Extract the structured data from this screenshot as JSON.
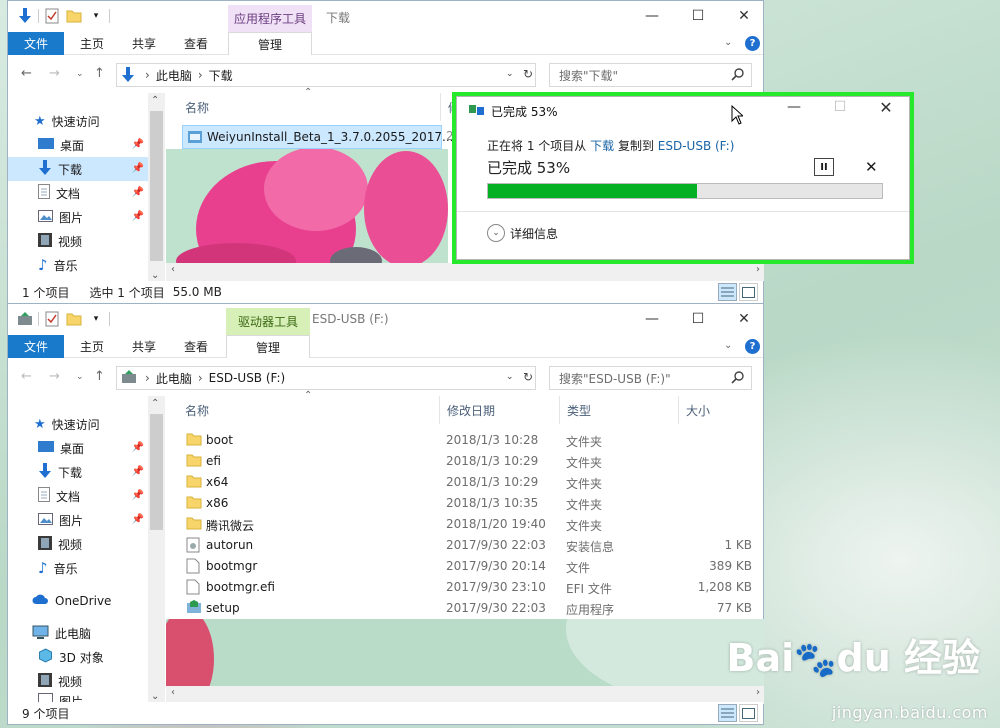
{
  "window1": {
    "context_tab": "应用程序工具",
    "title": "下载",
    "ribbon_tabs": [
      "文件",
      "主页",
      "共享",
      "查看",
      "管理"
    ],
    "address": {
      "root": "此电脑",
      "sep": "›",
      "folder": "下载"
    },
    "search_placeholder": "搜索\"下载\"",
    "nav": [
      {
        "label": "快速访问"
      },
      {
        "label": "桌面"
      },
      {
        "label": "下载"
      },
      {
        "label": "文档"
      },
      {
        "label": "图片"
      },
      {
        "label": "视频"
      },
      {
        "label": "音乐"
      }
    ],
    "col_name": "名称",
    "col_date_partial": "修",
    "file": {
      "name": "WeiyunInstall_Beta_1_3.7.0.2055_2017...",
      "date_partial": "2("
    },
    "status": {
      "items": "1 个项目",
      "selected": "选中 1 个项目",
      "size": "55.0 MB"
    }
  },
  "window2": {
    "context_tab": "驱动器工具",
    "title": "ESD-USB (F:)",
    "ribbon_tabs": [
      "文件",
      "主页",
      "共享",
      "查看",
      "管理"
    ],
    "address": {
      "root": "此电脑",
      "sep": "›",
      "folder": "ESD-USB (F:)"
    },
    "search_placeholder": "搜索\"ESD-USB (F:)\"",
    "nav": [
      {
        "label": "快速访问"
      },
      {
        "label": "桌面"
      },
      {
        "label": "下载"
      },
      {
        "label": "文档"
      },
      {
        "label": "图片"
      },
      {
        "label": "视频"
      },
      {
        "label": "音乐"
      },
      {
        "label": "OneDrive"
      },
      {
        "label": "此电脑"
      },
      {
        "label": "3D 对象"
      },
      {
        "label": "视频"
      },
      {
        "label": "图片"
      }
    ],
    "columns": {
      "name": "名称",
      "date": "修改日期",
      "type": "类型",
      "size": "大小"
    },
    "files": [
      {
        "name": "boot",
        "date": "2018/1/3 10:28",
        "type": "文件夹",
        "size": "",
        "icon": "folder-icon"
      },
      {
        "name": "efi",
        "date": "2018/1/3 10:29",
        "type": "文件夹",
        "size": "",
        "icon": "folder-icon"
      },
      {
        "name": "x64",
        "date": "2018/1/3 10:29",
        "type": "文件夹",
        "size": "",
        "icon": "folder-icon"
      },
      {
        "name": "x86",
        "date": "2018/1/3 10:35",
        "type": "文件夹",
        "size": "",
        "icon": "folder-icon"
      },
      {
        "name": "腾讯微云",
        "date": "2018/1/20 19:40",
        "type": "文件夹",
        "size": "",
        "icon": "folder-icon"
      },
      {
        "name": "autorun",
        "date": "2017/9/30 22:03",
        "type": "安装信息",
        "size": "1 KB",
        "icon": "setup-info-icon"
      },
      {
        "name": "bootmgr",
        "date": "2017/9/30 20:14",
        "type": "文件",
        "size": "389 KB",
        "icon": "file-icon"
      },
      {
        "name": "bootmgr.efi",
        "date": "2017/9/30 23:10",
        "type": "EFI 文件",
        "size": "1,208 KB",
        "icon": "file-icon"
      },
      {
        "name": "setup",
        "date": "2017/9/30 22:03",
        "type": "应用程序",
        "size": "77 KB",
        "icon": "setup-app-icon"
      }
    ],
    "status": {
      "items": "9 个项目"
    }
  },
  "dialog": {
    "title": "已完成 53%",
    "line_prefix": "正在将 1 个项目从",
    "source": "下载",
    "line_mid": "复制到",
    "dest": "ESD-USB (F:)",
    "progress_label": "已完成 53%",
    "progress": 0.53,
    "details": "详细信息",
    "accent": "#06b025",
    "highlight": "#27e92b"
  },
  "watermark": {
    "brand": "Baidu 经验",
    "url": "jingyan.baidu.com"
  }
}
